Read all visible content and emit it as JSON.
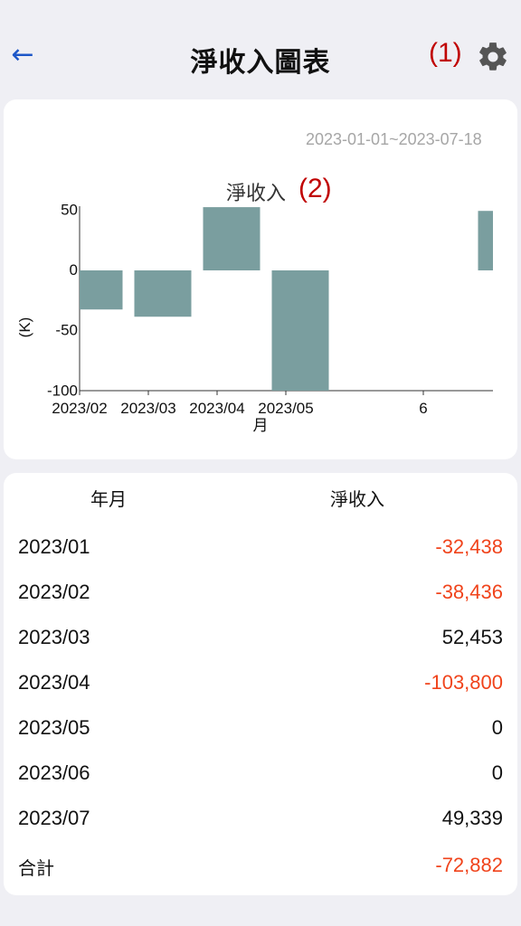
{
  "header": {
    "title": "淨收入圖表",
    "annotation_1": "(1)",
    "back_icon": "arrow-left-icon",
    "settings_icon": "gear-icon"
  },
  "chart_card": {
    "date_range": "2023-01-01~2023-07-18",
    "title": "淨收入",
    "annotation_2": "(2)"
  },
  "chart_data": {
    "type": "bar",
    "title": "淨收入",
    "xlabel": "月",
    "ylabel": "(K)",
    "ylim": [
      -110,
      55
    ],
    "yticks": [
      50,
      0,
      -50,
      -100
    ],
    "xticks": [
      "2023/02",
      "2023/03",
      "2023/04",
      "2023/05",
      "6"
    ],
    "categories": [
      "2023/01",
      "2023/02",
      "2023/03",
      "2023/04",
      "2023/05",
      "2023/06",
      "2023/07"
    ],
    "values": [
      -32.438,
      -38.436,
      52.453,
      -103.8,
      0,
      0,
      49.339
    ],
    "bar_color": "#7a9e9f",
    "grid": false
  },
  "table": {
    "col_month": "年月",
    "col_value": "淨收入",
    "rows": [
      {
        "month": "2023/01",
        "value": "-32,438",
        "negative": true
      },
      {
        "month": "2023/02",
        "value": "-38,436",
        "negative": true
      },
      {
        "month": "2023/03",
        "value": "52,453",
        "negative": false
      },
      {
        "month": "2023/04",
        "value": "-103,800",
        "negative": true
      },
      {
        "month": "2023/05",
        "value": "0",
        "negative": false
      },
      {
        "month": "2023/06",
        "value": "0",
        "negative": false
      },
      {
        "month": "2023/07",
        "value": "49,339",
        "negative": false
      }
    ],
    "total_label": "合計",
    "total_value": "-72,882",
    "total_negative": true
  },
  "colors": {
    "accent": "#1d57c8",
    "negative": "#f0431b",
    "annotation": "#c00000"
  }
}
